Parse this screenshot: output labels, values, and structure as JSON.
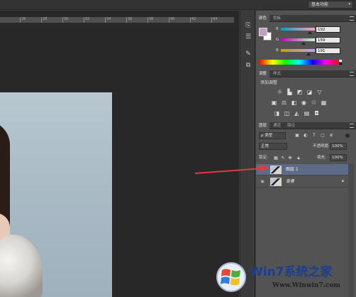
{
  "topbar": {
    "workspace_label": "基本功能"
  },
  "ruler": {
    "ticks": [
      "26",
      "28",
      "30",
      "32",
      "34",
      "36",
      "38",
      "40",
      "42",
      "44",
      "46"
    ]
  },
  "color_panel": {
    "tabs": [
      "颜色",
      "色板"
    ],
    "foreground": "#c09fbf",
    "background": "#ffffff",
    "sliders": [
      {
        "label": "R",
        "value": "192"
      },
      {
        "label": "G",
        "value": "159"
      },
      {
        "label": "B",
        "value": "191"
      }
    ]
  },
  "adjust_panel": {
    "tabs": [
      "调整",
      "样式"
    ],
    "title": "添加调整",
    "icons_row1": [
      "brightness-icon",
      "levels-icon",
      "curves-icon",
      "exposure-icon",
      "gradient-triangle-icon"
    ],
    "icons_row2": [
      "vibrance-icon",
      "balance-icon",
      "channel-mixer-icon",
      "photo-filter-icon",
      "color-lookup-icon",
      "selective-color-icon"
    ],
    "icons_row3": [
      "invert-icon",
      "posterize-icon",
      "threshold-icon",
      "gradient-map-icon",
      "black-white-icon"
    ]
  },
  "layers_panel": {
    "tabs": [
      "图层",
      "通道",
      "路径"
    ],
    "filter_kind": "ρ 类型",
    "blend_mode": "正常",
    "opacity_label": "不透明度:",
    "opacity_value": "100%",
    "lock_label": "锁定:",
    "fill_label": "填充:",
    "fill_value": "100%",
    "layers": [
      {
        "name": "图层 1",
        "selected": true
      },
      {
        "name": "背景",
        "selected": false
      }
    ]
  },
  "watermark": {
    "title": "Win7系统之家",
    "url": "Www.Winwin7.com"
  },
  "colors": {
    "accent_arrow": "#e03a3a",
    "selection": "#5e6b86"
  }
}
